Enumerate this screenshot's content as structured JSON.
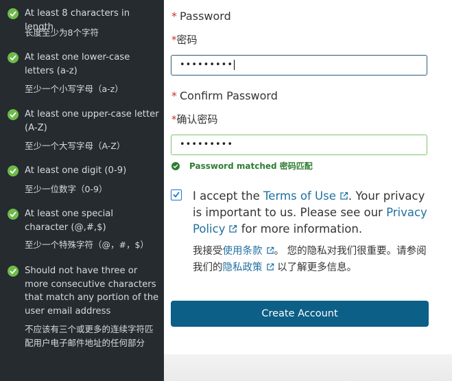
{
  "requirements": [
    {
      "en": "At least 8 characters in length",
      "zh": "长度至少为8个字符"
    },
    {
      "en": "At least one lower-case letters (a-z)",
      "zh": "至少一个小写字母（a-z）"
    },
    {
      "en": "At least one upper-case letter (A-Z)",
      "zh": "至少一个大写字母（A-Z）"
    },
    {
      "en": "At least one digit (0-9)",
      "zh": "至少一位数字（0-9）"
    },
    {
      "en": "At least one special character (@,#,$)",
      "zh": "至少一个特殊字符（@，#，$）"
    },
    {
      "en": "Should not have three or more consecutive characters that match any portion of the user email address",
      "zh": "不应该有三个或更多的连续字符匹配用户电子邮件地址的任何部分"
    }
  ],
  "password": {
    "label": "Password",
    "label_zh": "密码",
    "required_mark": "*",
    "value_masked": "•••••••••"
  },
  "confirm": {
    "label": "Confirm Password",
    "label_zh": "确认密码",
    "required_mark": "*",
    "value_masked": "•••••••••",
    "match_message": "Password matched 密码匹配"
  },
  "consent": {
    "checked": true,
    "text1": "I accept the ",
    "terms_link": "Terms of Use",
    "text2": ". Your privacy is important to us. Please see our ",
    "privacy_link": "Privacy Policy",
    "text3": " for more information.",
    "zh_text1": "我接受",
    "zh_terms_link": "使用条款",
    "zh_text2": "。 您的隐私对我们很重要。请参阅我们的",
    "zh_privacy_link": "隐私政策",
    "zh_text3": " 以了解更多信息。"
  },
  "submit_label": "Create Account",
  "colors": {
    "panel_bg": "#262b30",
    "check_green": "#6fba4a",
    "link": "#1f6f9f",
    "button": "#0c5f87",
    "success": "#2e7d32"
  }
}
